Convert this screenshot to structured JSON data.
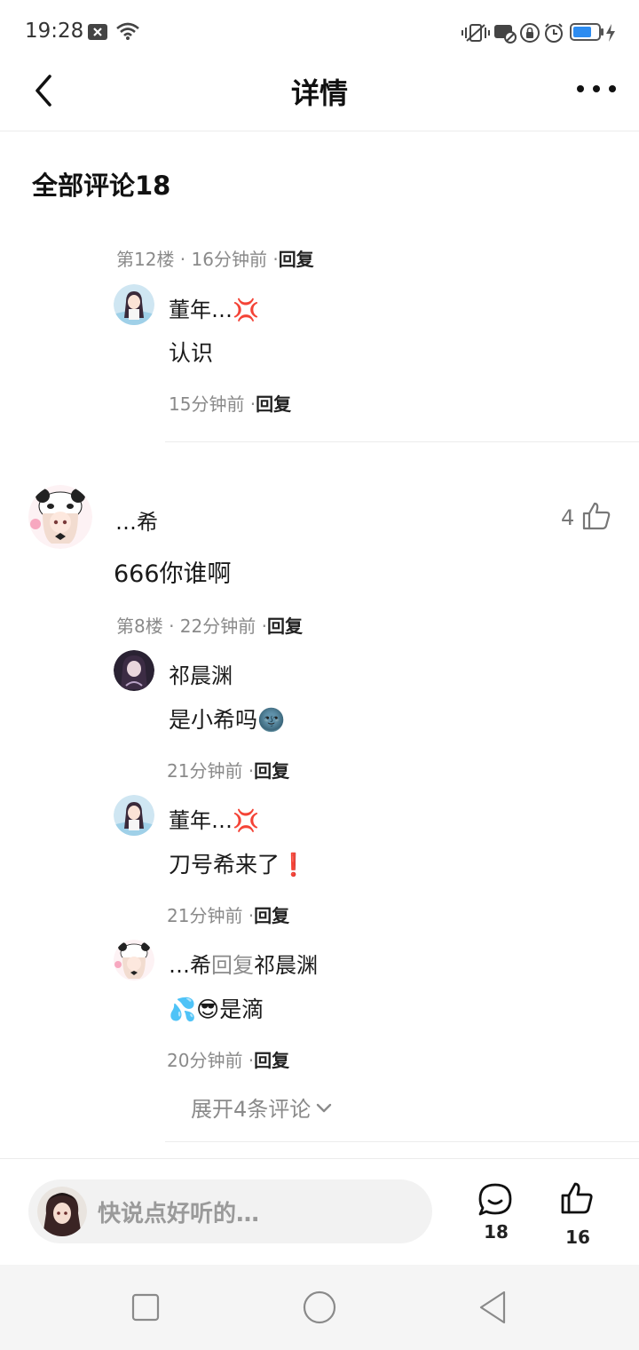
{
  "status_bar": {
    "time": "19:28",
    "icons": [
      "close-box-icon",
      "wifi-icon",
      "vibrate-icon",
      "message-off-icon",
      "lock-rotation-icon",
      "alarm-icon",
      "battery-icon",
      "charging-icon"
    ]
  },
  "header": {
    "title": "详情"
  },
  "section": {
    "title": "全部评论18"
  },
  "thread1": {
    "meta_prefix": "第12楼 · 16分钟前 ·",
    "reply_label": "回复",
    "replies": [
      {
        "user": "董年…💢",
        "content": "认识",
        "time": "15分钟前 ·",
        "reply_label": "回复"
      }
    ]
  },
  "thread2": {
    "user": "…希",
    "content": "666你谁啊",
    "likes": "4",
    "meta_prefix": "第8楼 · 22分钟前 ·",
    "reply_label": "回复",
    "replies": [
      {
        "user": "祁晨渊",
        "content": "是小希吗🌚",
        "time": "21分钟前 ·",
        "reply_label": "回复"
      },
      {
        "user": "董年…💢",
        "content": "刀号希来了❗",
        "time": "21分钟前 ·",
        "reply_label": "回复"
      },
      {
        "user": "…希",
        "reply_word": "回复",
        "reply_target": "祁晨渊",
        "content": "💦😎是滴",
        "time": "20分钟前 ·",
        "reply_label": "回复"
      }
    ],
    "expand_label": "展开4条评论"
  },
  "bottom_bar": {
    "placeholder": "快说点好听的…",
    "comment_count": "18",
    "like_count": "16"
  },
  "colors": {
    "accent_text": "#1a1a1a",
    "muted_text": "#8a8a8a",
    "divider": "#ececec"
  }
}
